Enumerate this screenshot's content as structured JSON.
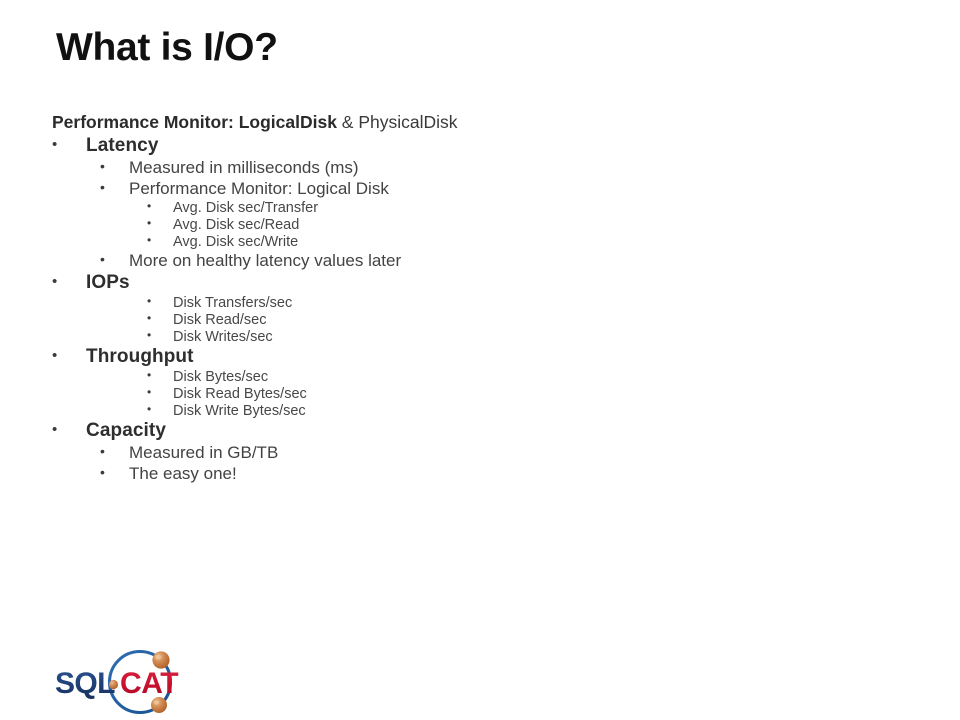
{
  "slide": {
    "title": "What is I/O?",
    "background_color": "#ffffff",
    "title_color": "#111111",
    "body_color": "#3a3a3a"
  },
  "body": {
    "lines": [
      {
        "level": 0,
        "bullet": "",
        "lead": "Performance Monitor: ",
        "strong": "LogicalDisk",
        "tail": " & PhysicalDisk",
        "text": "Performance Monitor: LogicalDisk & PhysicalDisk"
      },
      {
        "level": 1,
        "bullet": "•",
        "text": "Latency"
      },
      {
        "level": 2,
        "bullet": "•",
        "text": "Measured in milliseconds (ms)"
      },
      {
        "level": 2,
        "bullet": "•",
        "text": "Performance Monitor: Logical Disk"
      },
      {
        "level": 3,
        "bullet": "•",
        "text": "Avg. Disk sec/Transfer"
      },
      {
        "level": 3,
        "bullet": "•",
        "text": "Avg. Disk sec/Read"
      },
      {
        "level": 3,
        "bullet": "•",
        "text": "Avg. Disk sec/Write"
      },
      {
        "level": 2,
        "bullet": "•",
        "text": "More on healthy latency values later"
      },
      {
        "level": 1,
        "bullet": "•",
        "text": "IOPs"
      },
      {
        "level": 3,
        "bullet": "•",
        "text": "Disk Transfers/sec"
      },
      {
        "level": 3,
        "bullet": "•",
        "text": "Disk Read/sec"
      },
      {
        "level": 3,
        "bullet": "•",
        "text": "Disk Writes/sec"
      },
      {
        "level": 1,
        "bullet": "•",
        "text": "Throughput"
      },
      {
        "level": 3,
        "bullet": "•",
        "text": "Disk Bytes/sec"
      },
      {
        "level": 3,
        "bullet": "•",
        "text": "Disk Read Bytes/sec"
      },
      {
        "level": 3,
        "bullet": "•",
        "text": "Disk Write Bytes/sec"
      },
      {
        "level": 1,
        "bullet": "•",
        "text": "Capacity"
      },
      {
        "level": 2,
        "bullet": "•",
        "text": "Measured in GB/TB"
      },
      {
        "level": 2,
        "bullet": "•",
        "text": "The easy one!"
      }
    ]
  },
  "logo": {
    "name": "sqlcat-logo",
    "text_sql": "SQL",
    "text_cat": "CAT",
    "color_sql": "#1F3F77",
    "color_cat": "#C8102E",
    "color_ring": "#1F5FA9",
    "color_sphere": "#C8763C",
    "color_sphere_highlight": "#E5A776",
    "color_dot": "#D08242"
  }
}
